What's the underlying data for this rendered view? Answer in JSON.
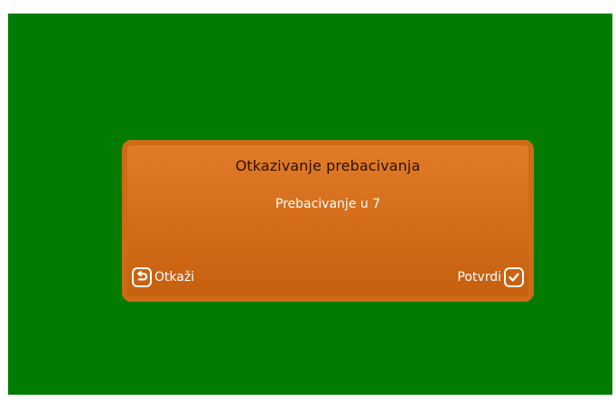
{
  "dialog": {
    "title": "Otkazivanje prebacivanja",
    "message": "Prebacivanje u 7",
    "cancel": {
      "label": "Otkaži",
      "icon": "back-arrow-icon"
    },
    "confirm": {
      "label": "Potvrdi",
      "icon": "checkmark-icon"
    }
  },
  "colors": {
    "background": "#017c00",
    "dialog_fill": "#d56f1b",
    "dialog_border": "#cd6c12",
    "title_text": "#2a1204",
    "button_text": "#ffffff"
  }
}
